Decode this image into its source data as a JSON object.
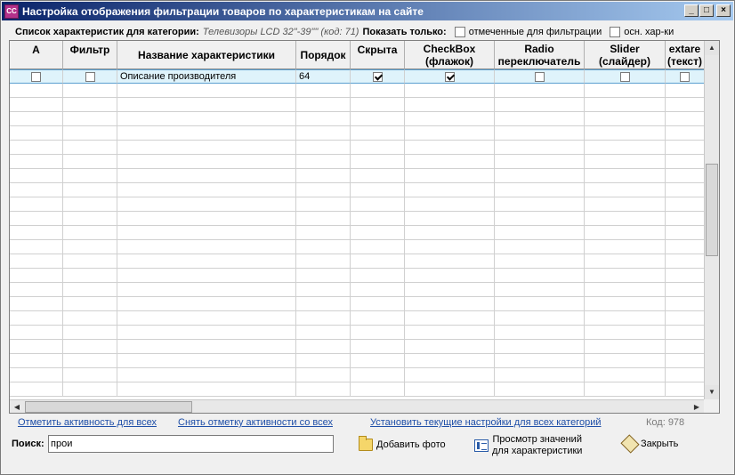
{
  "window": {
    "title": "Настройка отображения  фильтрации товаров по характеристикам на сайте",
    "icon": "cc-app-icon",
    "buttons": [
      "minimize",
      "maximize",
      "close"
    ]
  },
  "filter": {
    "label": "Список характеристик для категории:",
    "category": "Телевизоры LCD 32\"-39\"\" (код: 71)",
    "show_only_label": "Показать только:",
    "option_marked": "отмеченные для фильтрации",
    "option_main": "осн. хар-ки"
  },
  "grid": {
    "columns": [
      {
        "label": "А",
        "width": 60,
        "align": "top"
      },
      {
        "label": "Фильтр",
        "width": 61,
        "align": "top"
      },
      {
        "label": "Название характеристики",
        "width": 201,
        "align": "mid"
      },
      {
        "label": "Порядок",
        "width": 61,
        "align": "mid"
      },
      {
        "label": "Скрыта",
        "width": 61,
        "align": "top"
      },
      {
        "label": "CheckBox\n(флажок)",
        "width": 101,
        "align": "mid"
      },
      {
        "label": "Radio\nпереключатель",
        "width": 101,
        "align": "mid"
      },
      {
        "label": "Slider\n(слайдер)",
        "width": 91,
        "align": "mid"
      },
      {
        "label": "extare\n(текст)",
        "width": 44,
        "align": "mid"
      }
    ],
    "rows": [
      {
        "a": false,
        "filter": false,
        "name": "Описание производителя",
        "order": "64",
        "hidden": true,
        "checkbox": true,
        "radio": false,
        "slider": false,
        "textarea": false
      }
    ]
  },
  "links": {
    "mark_all": "Отметить активность для всех",
    "unmark_all": "Снять отметку активности со всех",
    "apply_all": "Установить текущие настройки для всех категорий",
    "code": "Код: 978"
  },
  "search": {
    "label": "Поиск:",
    "value": "прои"
  },
  "buttons": {
    "add_photo": "Добавить фото",
    "view_values": "Просмотр значений\nдля характеристики",
    "close": "Закрыть"
  }
}
